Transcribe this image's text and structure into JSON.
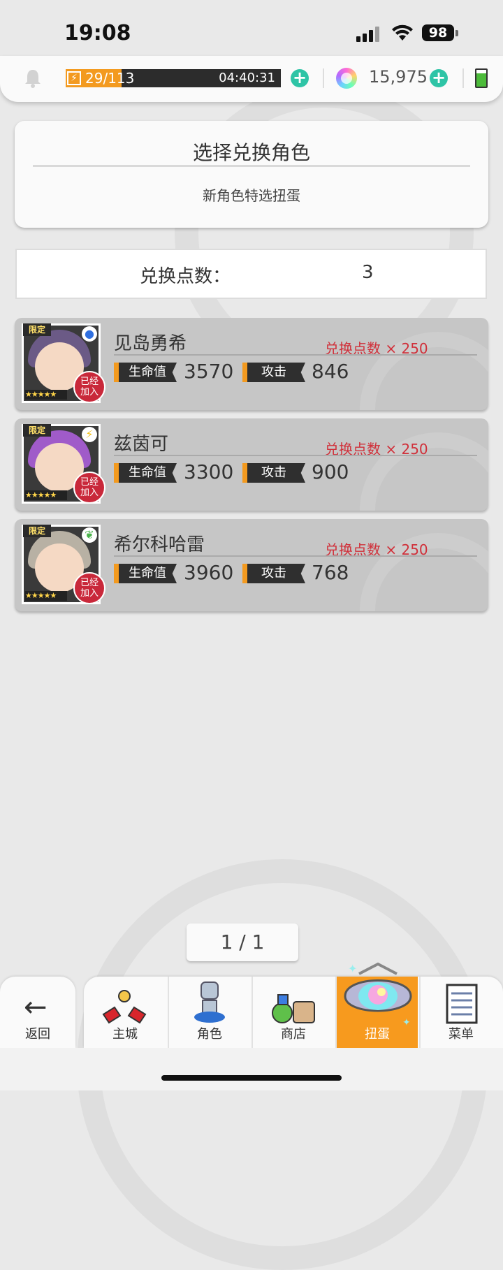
{
  "status_bar": {
    "time": "19:08",
    "battery": "98"
  },
  "top_bar": {
    "stamina_current": "29/",
    "stamina_max": "113",
    "stamina_fraction": 0.26,
    "stamina_timer": "04:40:31",
    "gems": "15,975"
  },
  "header": {
    "title": "选择兑换角色",
    "subtitle": "新角色特选扭蛋"
  },
  "points": {
    "label": "兑换点数：",
    "value": "3"
  },
  "characters": [
    {
      "name": "见岛勇希",
      "cost": "兑换点数 × 250",
      "hp_label": "生命值",
      "hp": "3570",
      "atk_label": "攻击",
      "atk": "846",
      "limited": "限定",
      "joined": "已经加入",
      "stars": "★★★★★",
      "hair": "#6b5a86",
      "attr": "water-icon"
    },
    {
      "name": "兹茵可",
      "cost": "兑换点数 × 250",
      "hp_label": "生命值",
      "hp": "3300",
      "atk_label": "攻击",
      "atk": "900",
      "limited": "限定",
      "joined": "已经加入",
      "stars": "★★★★★",
      "hair": "#a05bc9",
      "attr": "lightning-icon"
    },
    {
      "name": "希尔科哈雷",
      "cost": "兑换点数 × 250",
      "hp_label": "生命值",
      "hp": "3960",
      "atk_label": "攻击",
      "atk": "768",
      "limited": "限定",
      "joined": "已经加入",
      "stars": "★★★★★",
      "hair": "#b8b1a4",
      "attr": "leaf-icon"
    }
  ],
  "pager": "1 / 1",
  "nav": {
    "back": "返回",
    "items": [
      {
        "label": "主城",
        "icon": "castle-icon"
      },
      {
        "label": "角色",
        "icon": "character-icon"
      },
      {
        "label": "商店",
        "icon": "shop-icon"
      },
      {
        "label": "扭蛋",
        "icon": "gacha-icon",
        "active": true
      },
      {
        "label": "菜单",
        "icon": "menu-icon"
      }
    ]
  }
}
